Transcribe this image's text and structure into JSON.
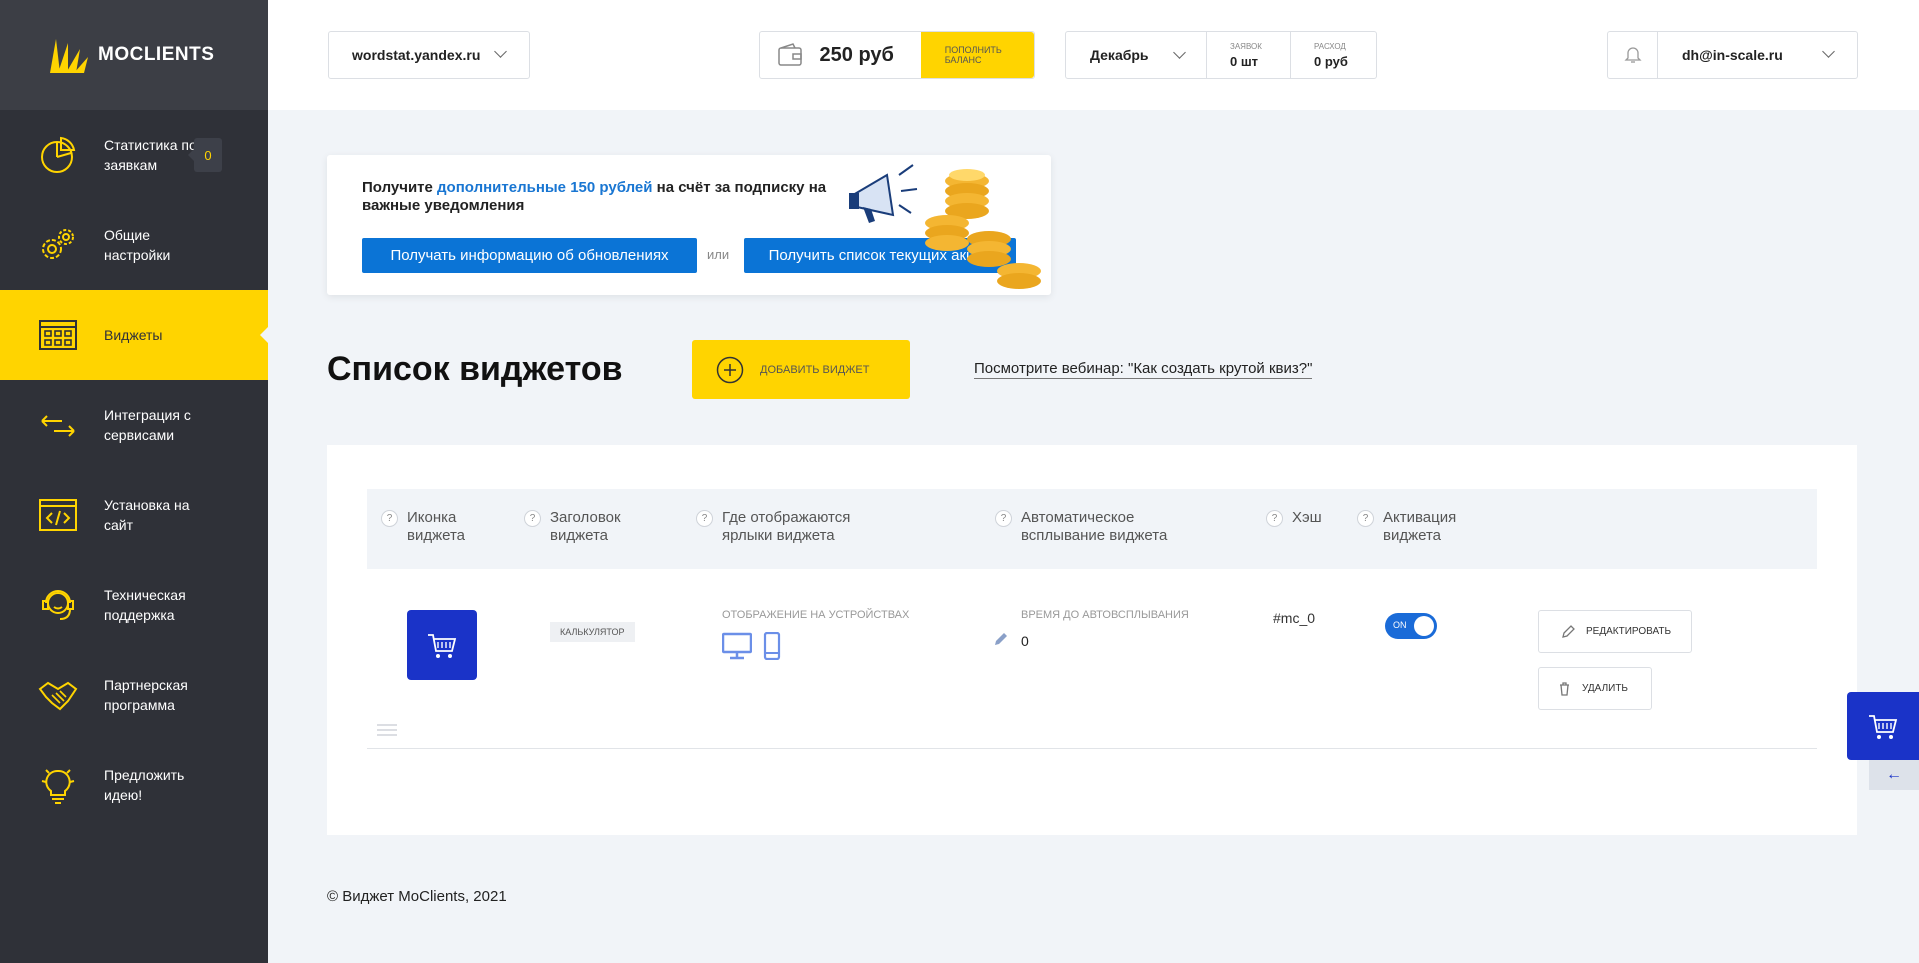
{
  "brand": {
    "name": "MOCLIENTS",
    "accent": "#ffd400",
    "sidebar_bg": "#2f3138",
    "primary_blue": "#0b74d6"
  },
  "sidebar": {
    "items": [
      {
        "label": "Статистика по заявкам",
        "icon": "pie-chart-icon",
        "badge": "0"
      },
      {
        "label": "Общие настройки",
        "icon": "gears-icon"
      },
      {
        "label": "Виджеты",
        "icon": "widgets-icon",
        "active": true
      },
      {
        "label": "Интеграция с сервисами",
        "icon": "arrows-exchange-icon"
      },
      {
        "label": "Установка на сайт",
        "icon": "code-window-icon"
      },
      {
        "label": "Техническая поддержка",
        "icon": "headset-support-icon"
      },
      {
        "label": "Партнерская программа",
        "icon": "handshake-icon"
      },
      {
        "label": "Предложить идею!",
        "icon": "lightbulb-icon"
      }
    ]
  },
  "header": {
    "site": "wordstat.yandex.ru",
    "balance": "250 руб",
    "topup_label": "Пополнить баланс",
    "month": "Декабрь",
    "requests_label": "Заявок",
    "requests_value": "0 шт",
    "spend_label": "Расход",
    "spend_value": "0 руб",
    "user_email": "dh@in-scale.ru"
  },
  "promo": {
    "text_before": "Получите ",
    "text_highlight": "дополнительные 150 рублей",
    "text_after": " на счёт за подписку на важные уведомления",
    "button_updates": "Получать информацию об обновлениях",
    "or": "или",
    "button_promos": "Получить список текущих акций"
  },
  "main": {
    "title": "Список виджетов",
    "add_button": "Добавить виджет",
    "webinar_link": "Посмотрите вебинар: \"Как создать крутой квиз?\""
  },
  "table": {
    "columns": [
      {
        "label": "Иконка виджета"
      },
      {
        "label": "Заголовок виджета"
      },
      {
        "label": "Где отображаются ярлыки виджета"
      },
      {
        "label": "Автоматическое всплывание виджета"
      },
      {
        "label": "Хэш"
      },
      {
        "label": "Активация виджета"
      }
    ],
    "help_mark": "?",
    "rows": [
      {
        "icon": "shopping-cart-icon",
        "title_tag": "Калькулятор",
        "devices_label": "Отображение на устройствах",
        "auto_label": "Время до автовсплывания",
        "auto_value": "0",
        "hash": "#mc_0",
        "toggle_label": "ON",
        "edit_label": "Редактировать",
        "delete_label": "Удалить"
      }
    ]
  },
  "footer": {
    "copyright": "© Виджет MoClients, 2021"
  },
  "floating": {
    "arrow": "←"
  }
}
